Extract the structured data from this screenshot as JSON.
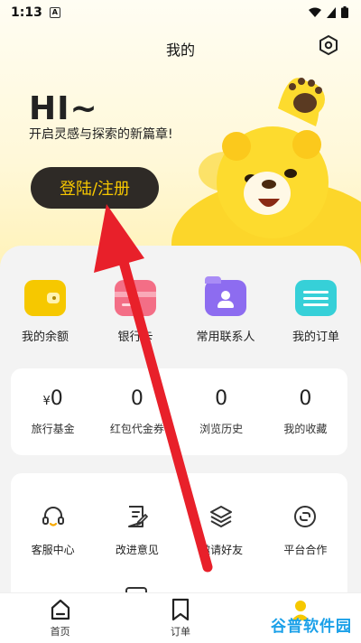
{
  "status_bar": {
    "time": "1:13",
    "badge": "A"
  },
  "header": {
    "title": "我的"
  },
  "hero": {
    "greeting": "HI~",
    "subtitle": "开启灵感与探索的新篇章!",
    "login_label": "登陆/注册"
  },
  "quick_actions": [
    {
      "label": "我的余额",
      "icon": "wallet-icon",
      "color": "#f6c800"
    },
    {
      "label": "银行卡",
      "icon": "bank-card-icon",
      "color": "#f36e86"
    },
    {
      "label": "常用联系人",
      "icon": "contacts-folder-icon",
      "color": "#8d6cf0"
    },
    {
      "label": "我的订单",
      "icon": "order-list-icon",
      "color": "#36d0d8"
    }
  ],
  "stats": [
    {
      "value": "0",
      "prefix": "¥",
      "label": "旅行基金"
    },
    {
      "value": "0",
      "label": "红包代金券"
    },
    {
      "value": "0",
      "label": "浏览历史"
    },
    {
      "value": "0",
      "label": "我的收藏"
    }
  ],
  "services": [
    {
      "label": "客服中心",
      "icon": "headset-icon"
    },
    {
      "label": "改进意见",
      "icon": "feedback-icon"
    },
    {
      "label": "邀请好友",
      "icon": "layers-icon"
    },
    {
      "label": "平台合作",
      "icon": "link-icon"
    }
  ],
  "tabs": [
    {
      "label": "首页",
      "icon": "home-icon"
    },
    {
      "label": "订单",
      "icon": "bookmark-icon"
    },
    {
      "label": "我的",
      "icon": "profile-icon"
    }
  ],
  "watermark": "谷普软件园",
  "colors": {
    "accent": "#f6c800",
    "login_bg": "#2e2a26",
    "arrow": "#e8202a"
  }
}
